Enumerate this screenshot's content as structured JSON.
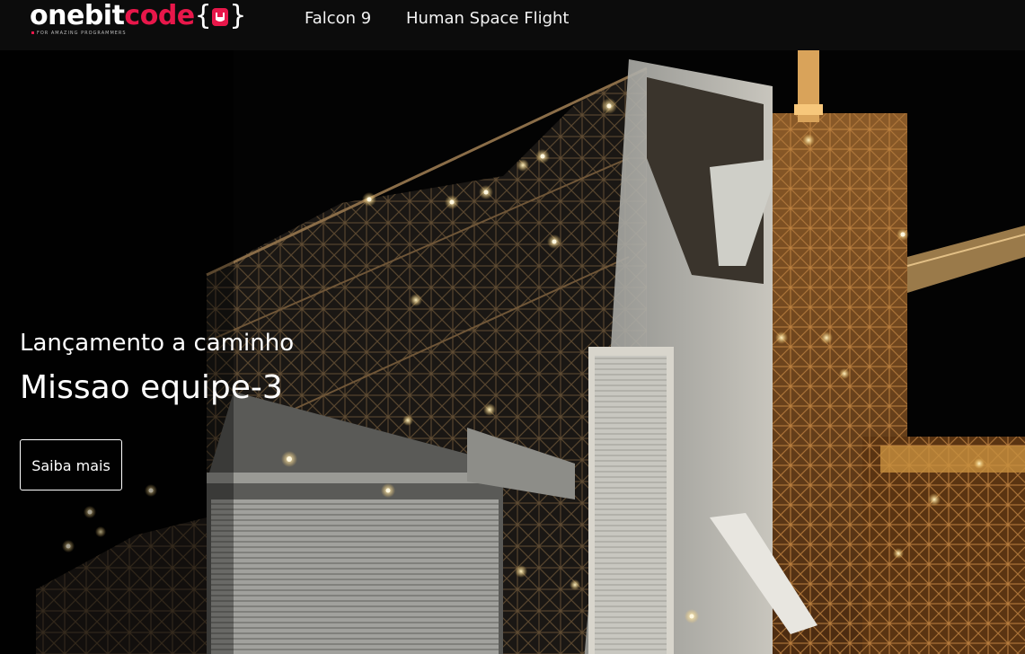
{
  "brand": {
    "name_part1": "onebit",
    "name_part2": "code",
    "braces": "{ }",
    "tagline": "FOR AMAZING PROGRAMMERS",
    "accent_color": "#e8174a"
  },
  "nav": {
    "links": [
      {
        "label": "Falcon 9"
      },
      {
        "label": "Human Space Flight"
      }
    ]
  },
  "hero": {
    "subtitle": "Lançamento a caminho",
    "title": "Missao equipe-3",
    "button_label": "Saiba mais",
    "image_subject": "launch-pad-tower-at-night"
  }
}
